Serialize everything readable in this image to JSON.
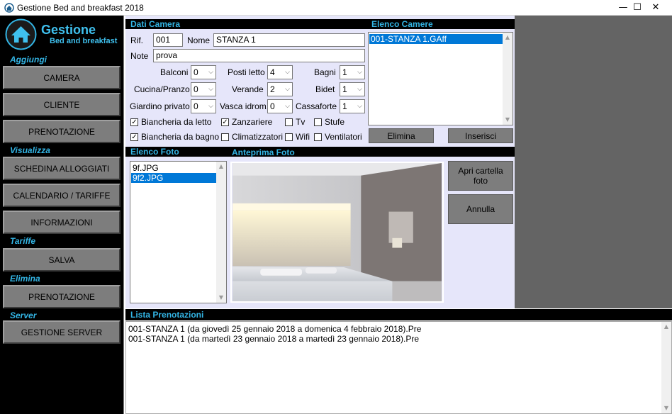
{
  "window": {
    "title": "Gestione Bed and breakfast 2018",
    "minimize": "—",
    "maximize": "☐",
    "close": "✕"
  },
  "sidebar": {
    "logo_title": "Gestione",
    "logo_subtitle": "Bed and breakfast",
    "sec_aggiungi": "Aggiungi",
    "btn_camera": "CAMERA",
    "btn_cliente": "CLIENTE",
    "btn_prenotazione_add": "PRENOTAZIONE",
    "sec_visualizza": "Visualizza",
    "btn_schedina": "SCHEDINA ALLOGGIATI",
    "btn_calendario": "CALENDARIO / TARIFFE",
    "btn_informazioni": "INFORMAZIONI",
    "sec_tariffe": "Tariffe",
    "btn_salva": "SALVA",
    "sec_elimina": "Elimina",
    "btn_prenotazione_del": "PRENOTAZIONE",
    "sec_server": "Server",
    "btn_gestione_server": "GESTIONE SERVER"
  },
  "camera": {
    "header": "Dati Camera",
    "rif_label": "Rif.",
    "rif_value": "001",
    "nome_label": "Nome",
    "nome_value": "STANZA 1",
    "note_label": "Note",
    "note_value": "prova",
    "balconi_label": "Balconi",
    "balconi_value": "0",
    "posti_label": "Posti letto",
    "posti_value": "4",
    "bagni_label": "Bagni",
    "bagni_value": "1",
    "cucina_label": "Cucina/Pranzo",
    "cucina_value": "0",
    "verande_label": "Verande",
    "verande_value": "2",
    "bidet_label": "Bidet",
    "bidet_value": "1",
    "giardino_label": "Giardino privato",
    "giardino_value": "0",
    "vasca_label": "Vasca idrom.",
    "vasca_value": "0",
    "cassaforte_label": "Cassaforte",
    "cassaforte_value": "1",
    "chk_biancheria_letto": "Biancheria da letto",
    "chk_zanzariere": "Zanzariere",
    "chk_tv": "Tv",
    "chk_stufe": "Stufe",
    "chk_biancheria_bagno": "Biancheria da bagno",
    "chk_climatizzatori": "Climatizzatori",
    "chk_wifi": "Wifi",
    "chk_ventilatori": "Ventilatori",
    "check_mark": "✓",
    "combo_arrow": "⌵"
  },
  "elenco_camere": {
    "header": "Elenco Camere",
    "items": [
      "001-STANZA 1.GAff"
    ],
    "btn_elimina": "Elimina",
    "btn_inserisci": "Inserisci"
  },
  "foto": {
    "header_elenco": "Elenco Foto",
    "header_anteprima": "Anteprima Foto",
    "items": [
      "9f.JPG",
      "9f2.JPG"
    ],
    "btn_apri": "Apri cartella foto",
    "btn_annulla": "Annulla"
  },
  "prenotazioni": {
    "header": "Lista Prenotazioni",
    "items": [
      "001-STANZA 1 (da giovedì 25 gennaio 2018 a domenica 4 febbraio 2018).Pre",
      "001-STANZA 1 (da martedì 23 gennaio 2018 a martedì 23 gennaio 2018).Pre"
    ]
  },
  "scroll": {
    "up": "▲",
    "down": "▼"
  }
}
